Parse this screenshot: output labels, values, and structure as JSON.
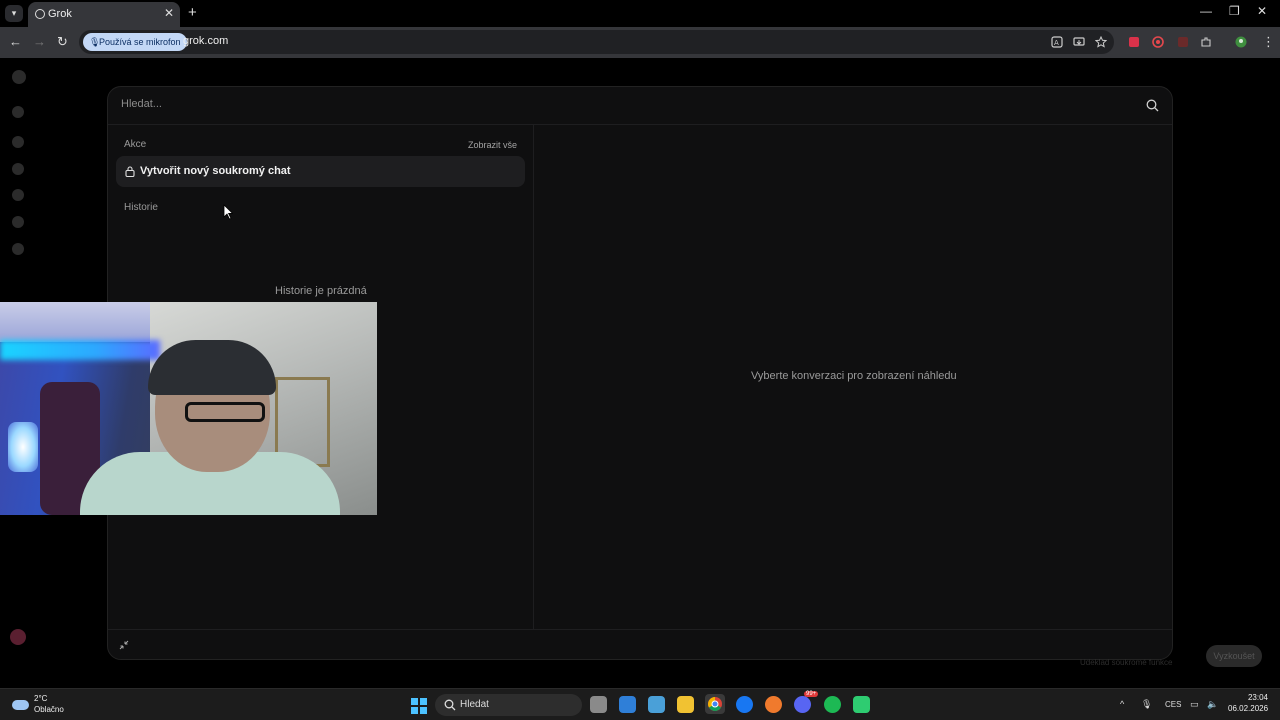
{
  "browser": {
    "tab_title": "Grok",
    "mic_chip": "Používá se mikrofon",
    "url": "grok.com"
  },
  "palette": {
    "search_placeholder": "Hledat...",
    "actions_label": "Akce",
    "show_all": "Zobrazit vše",
    "new_private_chat": "Vytvořit nový soukromý chat",
    "history_label": "Historie",
    "history_empty": "Historie je prázdná",
    "preview_placeholder": "Vyberte konverzaci pro zobrazení náhledu"
  },
  "background": {
    "toast_text": "Udeklad soukromé funkce",
    "toast_button": "Vyzkoušet"
  },
  "taskbar": {
    "weather_temp": "2°C",
    "weather_condition": "Oblačno",
    "search_label": "Hledat",
    "language": "CES",
    "time": "23:04",
    "date": "06.02.2026",
    "discord_badge": "99+"
  },
  "colors": {
    "page_bg": "#000000",
    "palette_bg": "#0f0f10",
    "action_item_bg": "#1e1e20",
    "chrome_toolbar": "#35363a",
    "mic_chip_bg": "#c3d8f6",
    "taskbar_bg": "#1c1c1c",
    "start_blue": "#4cc2ff"
  }
}
